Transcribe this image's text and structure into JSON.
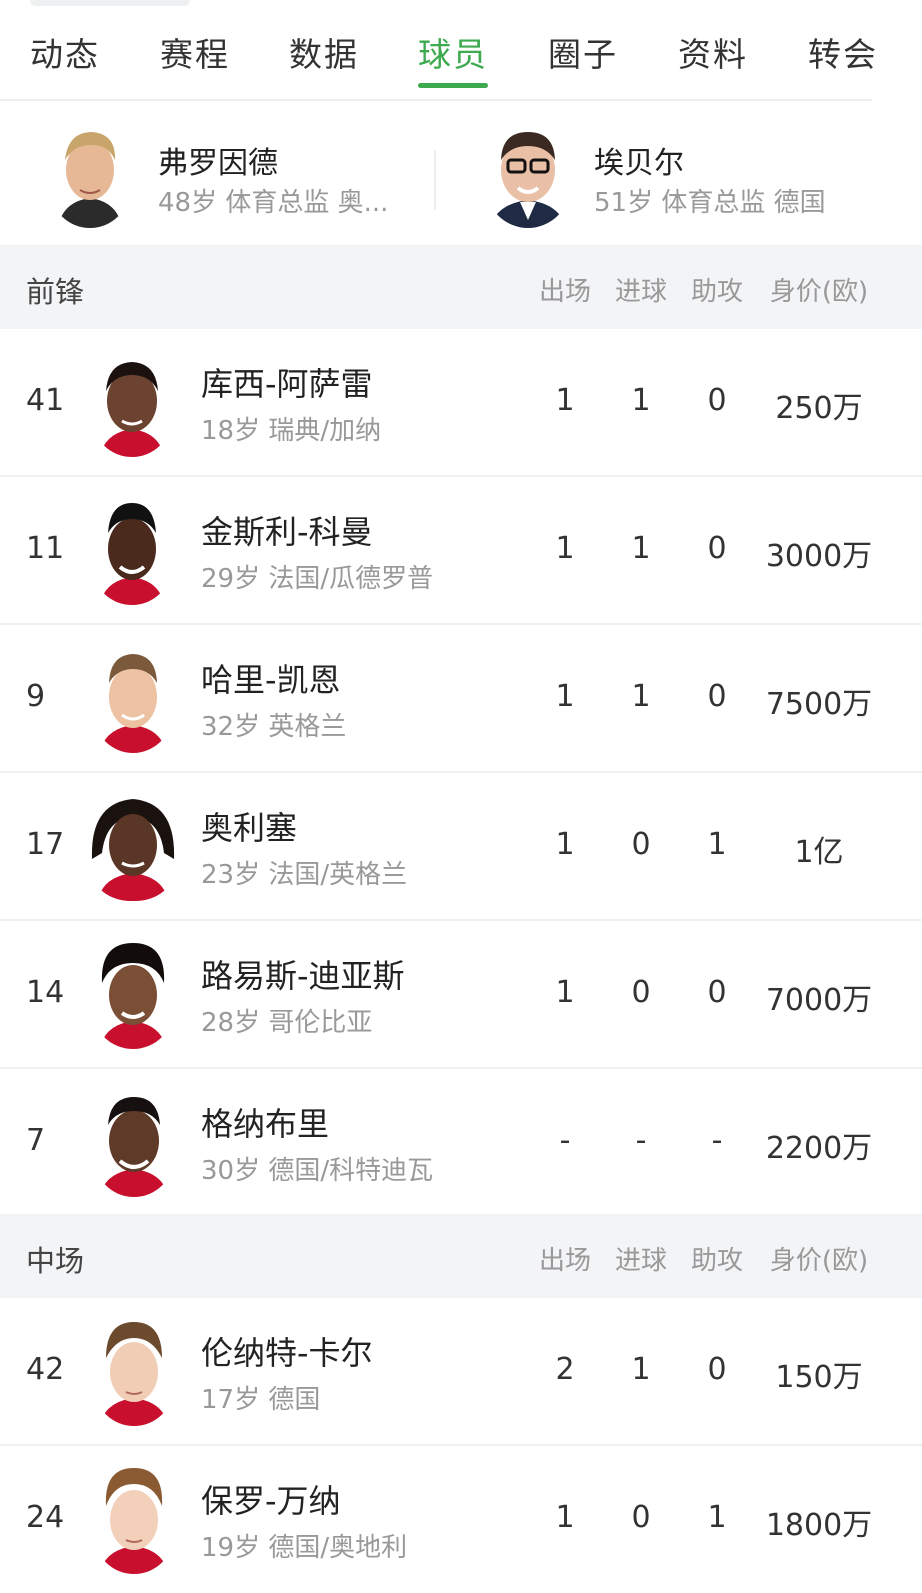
{
  "tabs": [
    "动态",
    "赛程",
    "数据",
    "球员",
    "圈子",
    "资料",
    "转会"
  ],
  "active_tab": "球员",
  "staff": [
    {
      "name": "弗罗因德",
      "info": "48岁 体育总监 奥..."
    },
    {
      "name": "埃贝尔",
      "info": "51岁 体育总监 德国"
    }
  ],
  "columns": {
    "apps": "出场",
    "goals": "进球",
    "assists": "助攻",
    "value": "身价(欧)"
  },
  "sections": [
    {
      "title": "前锋",
      "players": [
        {
          "number": "41",
          "name": "库西-阿萨雷",
          "info": "18岁 瑞典/加纳",
          "apps": "1",
          "goals": "1",
          "assists": "0",
          "value": "250万"
        },
        {
          "number": "11",
          "name": "金斯利-科曼",
          "info": "29岁 法国/瓜德罗普",
          "apps": "1",
          "goals": "1",
          "assists": "0",
          "value": "3000万"
        },
        {
          "number": "9",
          "name": "哈里-凯恩",
          "info": "32岁 英格兰",
          "apps": "1",
          "goals": "1",
          "assists": "0",
          "value": "7500万"
        },
        {
          "number": "17",
          "name": "奥利塞",
          "info": "23岁 法国/英格兰",
          "apps": "1",
          "goals": "0",
          "assists": "1",
          "value": "1亿"
        },
        {
          "number": "14",
          "name": "路易斯-迪亚斯",
          "info": "28岁 哥伦比亚",
          "apps": "1",
          "goals": "0",
          "assists": "0",
          "value": "7000万"
        },
        {
          "number": "7",
          "name": "格纳布里",
          "info": "30岁 德国/科特迪瓦",
          "apps": "-",
          "goals": "-",
          "assists": "-",
          "value": "2200万"
        }
      ]
    },
    {
      "title": "中场",
      "players": [
        {
          "number": "42",
          "name": "伦纳特-卡尔",
          "info": "17岁 德国",
          "apps": "2",
          "goals": "1",
          "assists": "0",
          "value": "150万"
        },
        {
          "number": "24",
          "name": "保罗-万纳",
          "info": "19岁 德国/奥地利",
          "apps": "1",
          "goals": "0",
          "assists": "1",
          "value": "1800万"
        }
      ]
    }
  ],
  "colors": {
    "accent": "#3daa4f",
    "section_bg": "#f3f4f6",
    "muted": "#999999"
  },
  "icons": [
    "staff-avatar-photo",
    "player-avatar-photo"
  ]
}
